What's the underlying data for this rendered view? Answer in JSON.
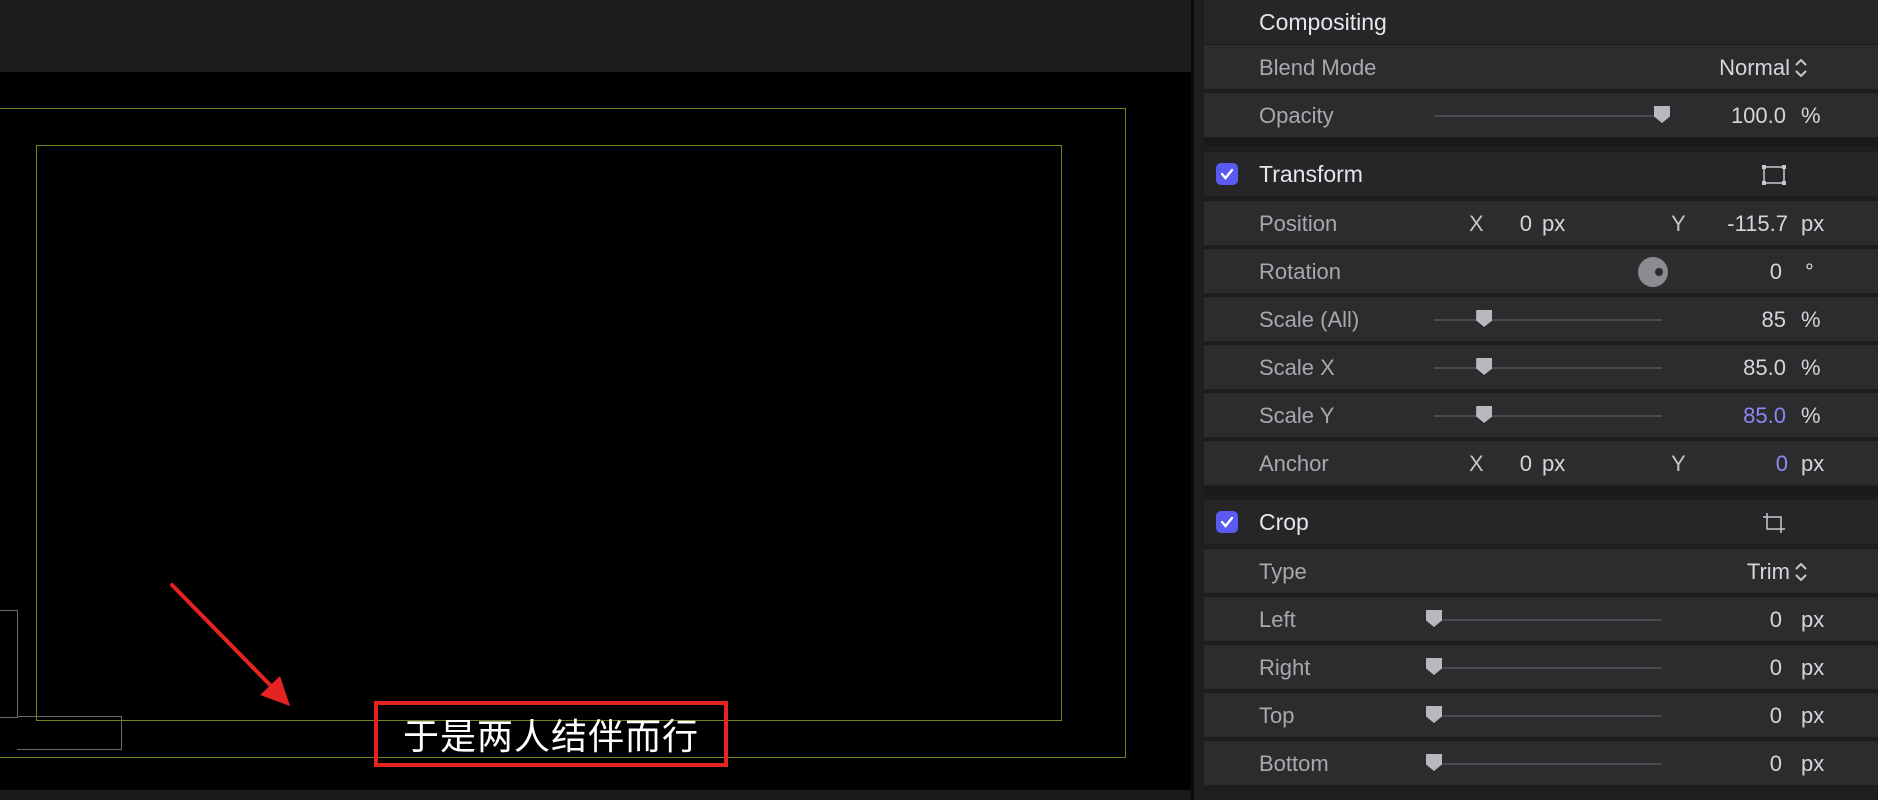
{
  "caption": {
    "text": "于是两人结伴而行"
  },
  "colors": {
    "accent_checkbox": "#5a5af0",
    "keyframed_value": "#8c88f2",
    "annotation_red": "#e52421"
  },
  "compositing": {
    "title": "Compositing",
    "blend_mode": {
      "label": "Blend Mode",
      "value": "Normal"
    },
    "opacity": {
      "label": "Opacity",
      "value": "100.0",
      "unit": "%",
      "slider_fraction": 1.0
    }
  },
  "transform": {
    "title": "Transform",
    "enabled": true,
    "icon": "transform-onscreen-icon",
    "position": {
      "label": "Position",
      "x_axis": "X",
      "x": "0",
      "x_unit": "px",
      "y_axis": "Y",
      "y": "-115.7",
      "y_unit": "px"
    },
    "rotation": {
      "label": "Rotation",
      "value": "0",
      "unit": "°"
    },
    "scale_all": {
      "label": "Scale (All)",
      "value": "85",
      "unit": "%",
      "slider_fraction": 0.22
    },
    "scale_x": {
      "label": "Scale X",
      "value": "85.0",
      "unit": "%",
      "slider_fraction": 0.22
    },
    "scale_y": {
      "label": "Scale Y",
      "value": "85.0",
      "unit": "%",
      "slider_fraction": 0.22
    },
    "anchor": {
      "label": "Anchor",
      "x_axis": "X",
      "x": "0",
      "x_unit": "px",
      "y_axis": "Y",
      "y": "0",
      "y_unit": "px"
    }
  },
  "crop": {
    "title": "Crop",
    "enabled": true,
    "icon": "crop-onscreen-icon",
    "type": {
      "label": "Type",
      "value": "Trim"
    },
    "left": {
      "label": "Left",
      "value": "0",
      "unit": "px",
      "slider_fraction": 0
    },
    "right": {
      "label": "Right",
      "value": "0",
      "unit": "px",
      "slider_fraction": 0
    },
    "top": {
      "label": "Top",
      "value": "0",
      "unit": "px",
      "slider_fraction": 0
    },
    "bottom": {
      "label": "Bottom",
      "value": "0",
      "unit": "px",
      "slider_fraction": 0
    }
  }
}
